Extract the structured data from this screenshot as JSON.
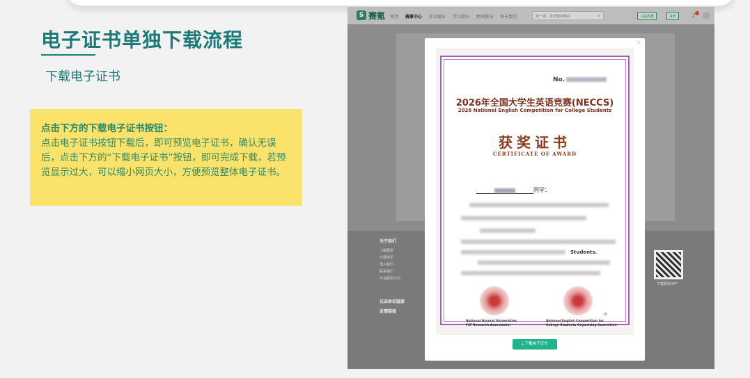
{
  "slide": {
    "title": "电子证书单独下载流程",
    "subtitle": "下载电子证书",
    "note_heading": "点击下方的下载电子证书按钮：",
    "note_body": "点击电子证书按钮下载后，即可预览电子证书，确认无误后，点击下方的“下载电子证书”按钮，即可完成下载，若预览显示过大，可以缩小网页大小，方便预览整体电子证书。"
  },
  "site": {
    "logo_text": "赛氪",
    "nav": [
      "首页",
      "赛事中心",
      "实训就业",
      "学习提升",
      "新闻资讯",
      "关于我们"
    ],
    "nav_active_index": 1,
    "search_placeholder": "搜一搜，发现更多精彩",
    "btn_enter": "入驻商家",
    "btn_publish": "发布",
    "footer_heading": "关于我们",
    "footer_links": [
      "了解赛氪",
      "元赛资讯",
      "加入我们",
      "联系我们",
      "平台服务公约"
    ],
    "footer_partner": "兄弟单位链接",
    "footer_friends": "友情链接",
    "qr_caption": "下载赛氪APP",
    "colors": {
      "accent": "#1fb48b",
      "brand": "#2e7d5b"
    }
  },
  "certificate": {
    "no_label": "No.",
    "title_cn": "2026年全国大学生英语竞赛(NECCS)",
    "title_en": "2026 National English Competition for College Students",
    "award_cn": "获奖证书",
    "award_en": "CERTIFICATE OF AWARD",
    "student_suffix": "同学：",
    "tail": "Students.",
    "date_suffix": "日",
    "org_left": [
      "National Normal Universities",
      "FLT Research Association"
    ],
    "org_right": [
      "National English Competition for",
      "College Students Organising Committee"
    ]
  },
  "modal": {
    "close": "×",
    "download_label": "下载电子证书",
    "download_icon": "download-icon"
  }
}
